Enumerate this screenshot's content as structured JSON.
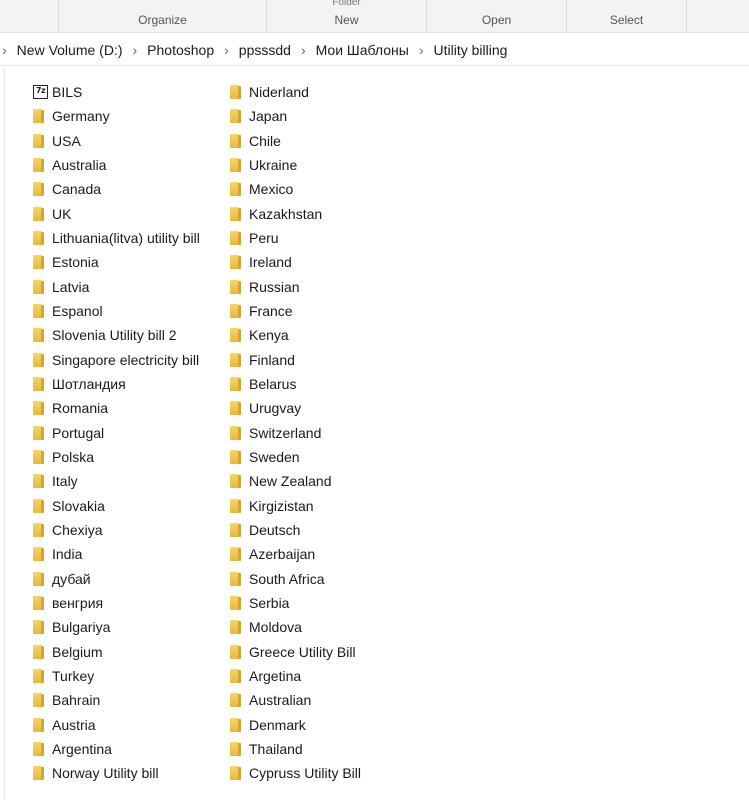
{
  "ribbon": {
    "groups": [
      {
        "label": "Organize"
      },
      {
        "label": "New",
        "stub": "Folder"
      },
      {
        "label": "Open"
      },
      {
        "label": "Select"
      }
    ]
  },
  "breadcrumb": [
    "New Volume (D:)",
    "Photoshop",
    "ppsssdd",
    "Мои Шаблоны",
    "Utility billing"
  ],
  "archive_icon_text": "7z",
  "columns": [
    [
      {
        "name": "BILS",
        "icon": "archive-7z-icon"
      },
      {
        "name": "Germany",
        "icon": "folder-icon"
      },
      {
        "name": "USA",
        "icon": "folder-icon"
      },
      {
        "name": "Australia",
        "icon": "folder-icon"
      },
      {
        "name": "Canada",
        "icon": "folder-icon"
      },
      {
        "name": "UK",
        "icon": "folder-icon"
      },
      {
        "name": "Lithuania(litva) utility bill",
        "icon": "folder-icon"
      },
      {
        "name": "Estonia",
        "icon": "folder-icon"
      },
      {
        "name": "Latvia",
        "icon": "folder-icon"
      },
      {
        "name": "Espanol",
        "icon": "folder-icon"
      },
      {
        "name": "Slovenia Utility bill 2",
        "icon": "folder-icon"
      },
      {
        "name": "Singapore electricity bill",
        "icon": "folder-icon"
      },
      {
        "name": "Шотландия",
        "icon": "folder-icon"
      },
      {
        "name": "Romania",
        "icon": "folder-icon"
      },
      {
        "name": "Portugal",
        "icon": "folder-icon"
      },
      {
        "name": "Polska",
        "icon": "folder-icon"
      },
      {
        "name": "Italy",
        "icon": "folder-icon"
      },
      {
        "name": "Slovakia",
        "icon": "folder-icon"
      },
      {
        "name": "Chexiya",
        "icon": "folder-icon"
      },
      {
        "name": "India",
        "icon": "folder-icon"
      },
      {
        "name": "дубай",
        "icon": "folder-icon"
      },
      {
        "name": "венгрия",
        "icon": "folder-icon"
      },
      {
        "name": "Bulgariya",
        "icon": "folder-icon"
      },
      {
        "name": "Belgium",
        "icon": "folder-icon"
      },
      {
        "name": "Turkey",
        "icon": "folder-icon"
      },
      {
        "name": "Bahrain",
        "icon": "folder-icon"
      },
      {
        "name": "Austria",
        "icon": "folder-icon"
      },
      {
        "name": "Argentina",
        "icon": "folder-icon"
      },
      {
        "name": "Norway Utility bill",
        "icon": "folder-icon"
      }
    ],
    [
      {
        "name": "Niderland",
        "icon": "folder-icon"
      },
      {
        "name": "Japan",
        "icon": "folder-icon"
      },
      {
        "name": "Chile",
        "icon": "folder-icon"
      },
      {
        "name": "Ukraine",
        "icon": "folder-icon"
      },
      {
        "name": "Mexico",
        "icon": "folder-icon"
      },
      {
        "name": "Kazakhstan",
        "icon": "folder-icon"
      },
      {
        "name": "Peru",
        "icon": "folder-icon"
      },
      {
        "name": "Ireland",
        "icon": "folder-icon"
      },
      {
        "name": "Russian",
        "icon": "folder-icon"
      },
      {
        "name": "France",
        "icon": "folder-icon"
      },
      {
        "name": "Kenya",
        "icon": "folder-icon"
      },
      {
        "name": "Finland",
        "icon": "folder-icon"
      },
      {
        "name": "Belarus",
        "icon": "folder-icon"
      },
      {
        "name": "Urugvay",
        "icon": "folder-icon"
      },
      {
        "name": "Switzerland",
        "icon": "folder-icon"
      },
      {
        "name": "Sweden",
        "icon": "folder-icon"
      },
      {
        "name": "New Zealand",
        "icon": "folder-icon"
      },
      {
        "name": "Kirgizistan",
        "icon": "folder-icon"
      },
      {
        "name": "Deutsch",
        "icon": "folder-icon"
      },
      {
        "name": "Azerbaijan",
        "icon": "folder-icon"
      },
      {
        "name": "South Africa",
        "icon": "folder-icon"
      },
      {
        "name": "Serbia",
        "icon": "folder-icon"
      },
      {
        "name": "Moldova",
        "icon": "folder-icon"
      },
      {
        "name": "Greece Utility Bill",
        "icon": "folder-icon"
      },
      {
        "name": "Argetina",
        "icon": "folder-icon"
      },
      {
        "name": "Australian",
        "icon": "folder-icon"
      },
      {
        "name": "Denmark",
        "icon": "folder-icon"
      },
      {
        "name": "Thailand",
        "icon": "folder-icon"
      },
      {
        "name": "Cypruss Utility Bill",
        "icon": "folder-icon"
      }
    ]
  ],
  "colors": {
    "folder": "#f0c24b",
    "ribbon_bg": "#f3f3f3",
    "text": "#1a1a1a"
  }
}
